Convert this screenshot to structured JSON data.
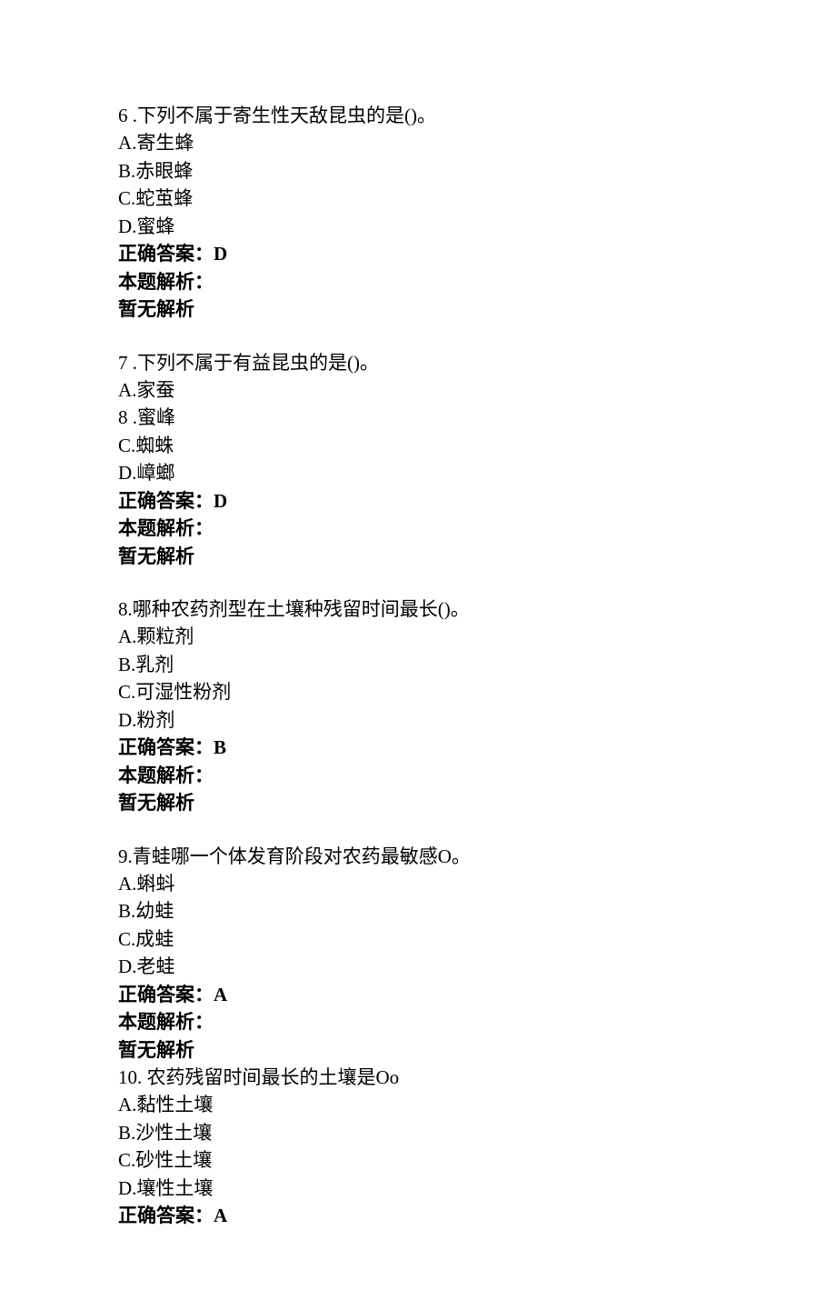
{
  "questions": [
    {
      "number": "6",
      "numSep": " .",
      "stem": "下列不属于寄生性天敌昆虫的是()。",
      "options": [
        {
          "label": "A.",
          "text": "寄生蜂"
        },
        {
          "label": "B.",
          "text": "赤眼蜂"
        },
        {
          "label": "C.",
          "text": "蛇茧蜂"
        },
        {
          "label": "D.",
          "text": "蜜蜂"
        }
      ],
      "answerLabel": "正确答案：",
      "answer": "D",
      "analysisLabel": "本题解析：",
      "analysisText": "暂无解析"
    },
    {
      "number": "7",
      "numSep": " .",
      "stem": "下列不属于有益昆虫的是()。",
      "options": [
        {
          "label": "A.",
          "text": "家蚕"
        },
        {
          "label": "8 .",
          "text": "蜜峰"
        },
        {
          "label": "C.",
          "text": "蜘蛛"
        },
        {
          "label": "D.",
          "text": "嶂螂"
        }
      ],
      "answerLabel": "正确答案：",
      "answer": "D",
      "analysisLabel": "本题解析：",
      "analysisText": "暂无解析"
    },
    {
      "number": "8.",
      "numSep": "",
      "stem": "哪种农药剂型在土壤种残留时间最长()。",
      "options": [
        {
          "label": "A.",
          "text": "颗粒剂"
        },
        {
          "label": "B.",
          "text": "乳剂"
        },
        {
          "label": "C.",
          "text": "可湿性粉剂"
        },
        {
          "label": "D.",
          "text": "粉剂"
        }
      ],
      "answerLabel": "正确答案：",
      "answer": "B",
      "analysisLabel": "本题解析：",
      "analysisText": "暂无解析"
    },
    {
      "number": "9.",
      "numSep": "",
      "stem": "青蛙哪一个体发育阶段对农药最敏感O。",
      "options": [
        {
          "label": "A.",
          "text": "蝌蚪"
        },
        {
          "label": "B.",
          "text": "幼蛙"
        },
        {
          "label": "C.",
          "text": "成蛙"
        },
        {
          "label": "D.",
          "text": "老蛙"
        }
      ],
      "answerLabel": "正确答案：",
      "answer": "A",
      "analysisLabel": "本题解析：",
      "analysisText": "暂无解析"
    },
    {
      "number": "10.",
      "numSep": " ",
      "stem": "农药残留时间最长的土壤是Oo",
      "options": [
        {
          "label": "A.",
          "text": "黏性土壤"
        },
        {
          "label": "B.",
          "text": "沙性土壤"
        },
        {
          "label": "C.",
          "text": "砂性土壤"
        },
        {
          "label": "D.",
          "text": "壤性土壤"
        }
      ],
      "answerLabel": "正确答案：",
      "answer": "A",
      "analysisLabel": "",
      "analysisText": ""
    }
  ]
}
